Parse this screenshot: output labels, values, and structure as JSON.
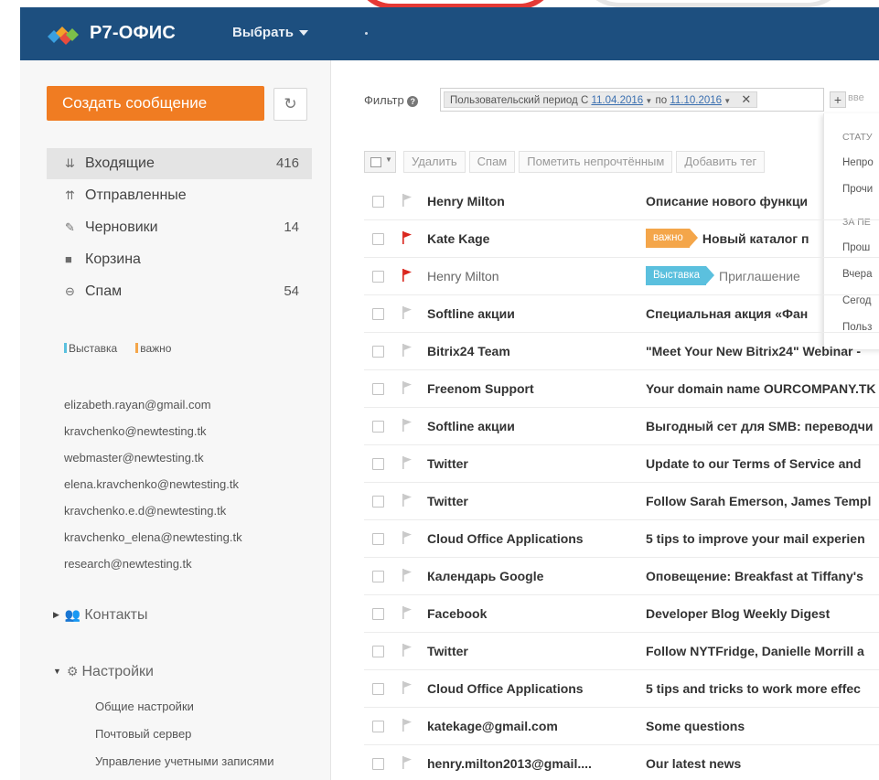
{
  "colors": {
    "header": "#1d4f7f",
    "primary_button": "#f07c22",
    "tag_exhibition": "#5bc0de",
    "tag_important": "#f4a64a",
    "flag_red": "#d9251d"
  },
  "header": {
    "logo_text": "Р7-ОФИС",
    "choose_label": "Выбрать"
  },
  "sidebar": {
    "create_label": "Создать сообщение",
    "folders": [
      {
        "label": "Входящие",
        "count": "416",
        "icon": "inbox-icon"
      },
      {
        "label": "Отправленные",
        "count": "",
        "icon": "sent-icon"
      },
      {
        "label": "Черновики",
        "count": "14",
        "icon": "drafts-icon"
      },
      {
        "label": "Корзина",
        "count": "",
        "icon": "trash-icon"
      },
      {
        "label": "Спам",
        "count": "54",
        "icon": "spam-icon"
      }
    ],
    "tags": [
      {
        "label": "Выставка",
        "color": "#5bc0de"
      },
      {
        "label": "важно",
        "color": "#f4a64a"
      }
    ],
    "accounts": [
      "elizabeth.rayan@gmail.com",
      "kravchenko@newtesting.tk",
      "webmaster@newtesting.tk",
      "elena.kravchenko@newtesting.tk",
      "kravchenko.e.d@newtesting.tk",
      "kravchenko_elena@newtesting.tk",
      "research@newtesting.tk"
    ],
    "contacts_label": "Контакты",
    "settings_label": "Настройки",
    "settings_items": [
      "Общие настройки",
      "Почтовый сервер",
      "Управление учетными записями"
    ]
  },
  "filter": {
    "label": "Фильтр",
    "period_text": "Пользовательский период С",
    "date_from": "11.04.2016",
    "to_text": "по",
    "date_to": "11.10.2016",
    "input_placeholder": "вве"
  },
  "filter_dropdown": {
    "status_header": "СТАТУ",
    "unread": "Непро",
    "read": "Прочи",
    "period_header": "ЗА ПЕ",
    "last": "Прош",
    "yesterday": "Вчера",
    "today": "Сегод",
    "custom": "Польз"
  },
  "toolbar": {
    "delete": "Удалить",
    "spam": "Спам",
    "mark_unread": "Пометить непрочтённым",
    "add_tag": "Добавить тег"
  },
  "messages": [
    {
      "from": "Henry Milton",
      "subject": "Описание нового функци",
      "unread": true,
      "flagged": false,
      "tag": ""
    },
    {
      "from": "Kate Kage",
      "subject": "Новый каталог п",
      "unread": true,
      "flagged": true,
      "tag": "важно",
      "tag_color": "#f4a64a"
    },
    {
      "from": "Henry Milton",
      "subject": "Приглашение",
      "unread": false,
      "flagged": true,
      "tag": "Выставка",
      "tag_color": "#5bc0de"
    },
    {
      "from": "Softline акции",
      "subject": "Специальная акция «Фан",
      "unread": true,
      "flagged": false,
      "tag": ""
    },
    {
      "from": "Bitrix24 Team",
      "subject": "\"Meet Your New Bitrix24\" Webinar -",
      "unread": true,
      "flagged": false,
      "tag": ""
    },
    {
      "from": "Freenom Support",
      "subject": "Your domain name OURCOMPANY.TK",
      "unread": true,
      "flagged": false,
      "tag": ""
    },
    {
      "from": "Softline акции",
      "subject": "Выгодный сет для SMB: переводчи",
      "unread": true,
      "flagged": false,
      "tag": ""
    },
    {
      "from": "Twitter",
      "subject": "Update to our Terms of Service and",
      "unread": true,
      "flagged": false,
      "tag": ""
    },
    {
      "from": "Twitter",
      "subject": "Follow Sarah Emerson, James Templ",
      "unread": true,
      "flagged": false,
      "tag": ""
    },
    {
      "from": "Cloud Office Applications",
      "subject": "5 tips to improve your mail experien",
      "unread": true,
      "flagged": false,
      "tag": ""
    },
    {
      "from": "Календарь Google",
      "subject": "Оповещение: Breakfast at Tiffany's",
      "unread": true,
      "flagged": false,
      "tag": ""
    },
    {
      "from": "Facebook",
      "subject": "Developer Blog Weekly Digest",
      "unread": true,
      "flagged": false,
      "tag": ""
    },
    {
      "from": "Twitter",
      "subject": "Follow NYTFridge, Danielle Morrill a",
      "unread": true,
      "flagged": false,
      "tag": ""
    },
    {
      "from": "Cloud Office Applications",
      "subject": "5 tips and tricks to work more effec",
      "unread": true,
      "flagged": false,
      "tag": ""
    },
    {
      "from": "katekage@gmail.com",
      "subject": "Some questions",
      "unread": true,
      "flagged": false,
      "tag": ""
    },
    {
      "from": "henry.milton2013@gmail....",
      "subject": "Our latest news",
      "unread": true,
      "flagged": false,
      "tag": ""
    }
  ]
}
